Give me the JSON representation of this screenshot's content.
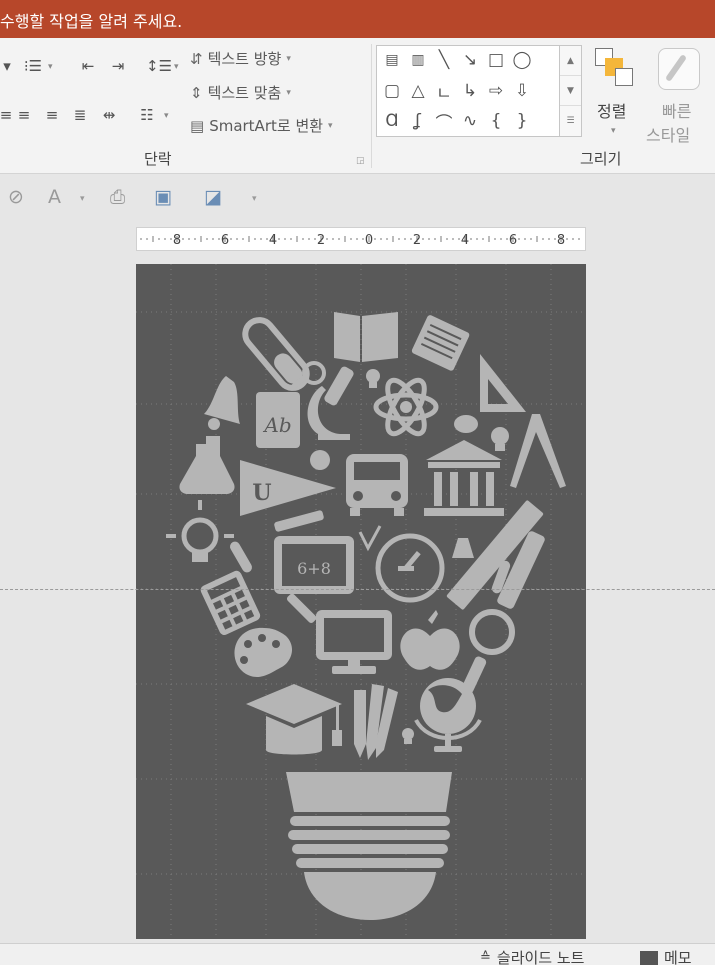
{
  "title_bar": {
    "tell_me": "수행할 작업을 알려 주세요."
  },
  "ribbon": {
    "paragraph": {
      "text_direction_label": "텍스트 방향",
      "align_text_label": "텍스트 맞춤",
      "smartart_label": "SmartArt로 변환",
      "group_label": "단락"
    },
    "drawing": {
      "arrange_label": "정렬",
      "quick_styles_label_1": "빠른",
      "quick_styles_label_2": "스타일",
      "group_label": "그리기"
    }
  },
  "ruler": {
    "labels": [
      "8",
      "6",
      "4",
      "2",
      "0",
      "2",
      "4",
      "6",
      "8"
    ]
  },
  "slide": {
    "calculator_text": "6+8",
    "pennant_letter": "U",
    "book_text": "Ab"
  },
  "status_bar": {
    "notes_label": "슬라이드 노트",
    "comments_label": "메모"
  },
  "colors": {
    "title_bar": "#b7472a",
    "slide_bg": "#595959",
    "illustration": "#b5b5b5"
  }
}
